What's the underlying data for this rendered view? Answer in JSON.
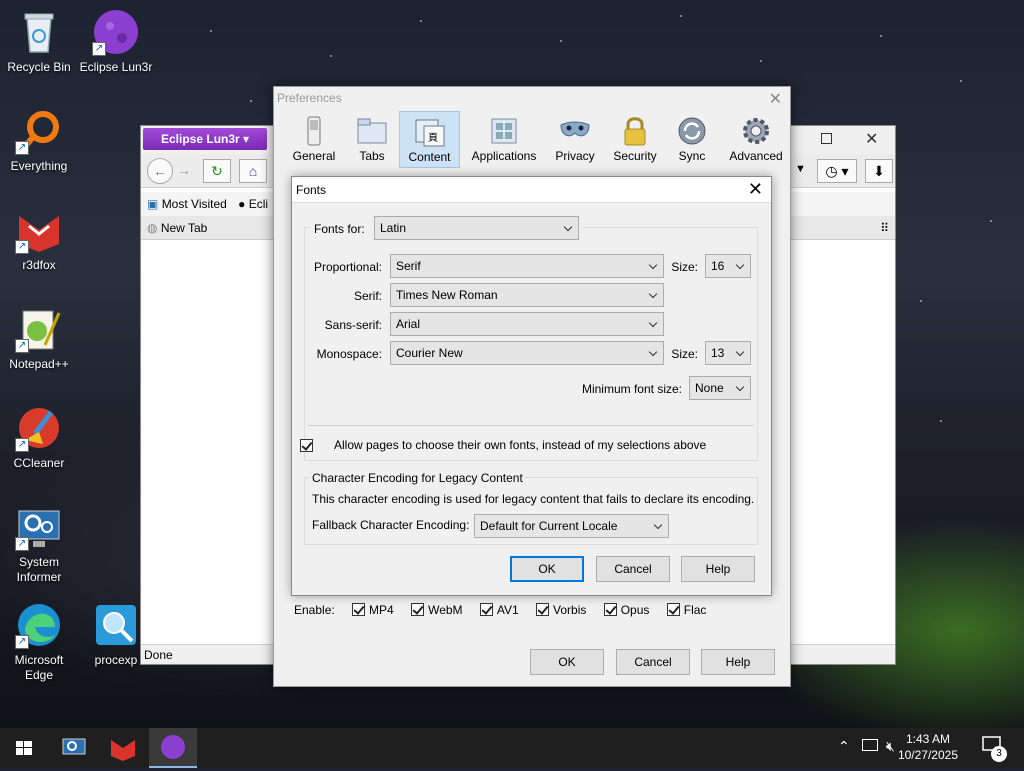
{
  "desktop": {
    "icons": [
      {
        "label": "Recycle Bin",
        "icon": "recycle-bin-icon"
      },
      {
        "label": "Eclipse Lun3r",
        "icon": "eclipse-lun3r-icon"
      },
      {
        "label": "Everything",
        "icon": "everything-search-icon"
      },
      {
        "label": "r3dfox",
        "icon": "r3dfox-icon"
      },
      {
        "label": "Notepad++",
        "icon": "notepad-plus-plus-icon"
      },
      {
        "label": "CCleaner",
        "icon": "ccleaner-icon"
      },
      {
        "label": "System Informer",
        "icon": "system-informer-icon"
      },
      {
        "label": "Microsoft Edge",
        "icon": "edge-icon"
      },
      {
        "label": "procexp",
        "icon": "procexp-icon"
      }
    ]
  },
  "browser": {
    "app_button": "Eclipse Lun3r",
    "bookmarks": [
      "Most Visited",
      "Ecli"
    ],
    "tab_label": "New Tab",
    "status": "Done"
  },
  "preferences": {
    "title": "Preferences",
    "panes": [
      {
        "label": "General",
        "icon": "general-switch-icon"
      },
      {
        "label": "Tabs",
        "icon": "tabs-icon"
      },
      {
        "label": "Content",
        "icon": "content-icon",
        "active": true
      },
      {
        "label": "Applications",
        "icon": "applications-icon"
      },
      {
        "label": "Privacy",
        "icon": "privacy-mask-icon"
      },
      {
        "label": "Security",
        "icon": "security-lock-icon"
      },
      {
        "label": "Sync",
        "icon": "sync-icon"
      },
      {
        "label": "Advanced",
        "icon": "advanced-gear-icon"
      }
    ],
    "enable_label": "Enable:",
    "formats": [
      "MP4",
      "WebM",
      "AV1",
      "Vorbis",
      "Opus",
      "Flac"
    ],
    "ok": "OK",
    "cancel": "Cancel",
    "help": "Help"
  },
  "fonts_dialog": {
    "title": "Fonts",
    "fonts_for_label": "Fonts for:",
    "fonts_for_value": "Latin",
    "proportional_label": "Proportional:",
    "proportional_value": "Serif",
    "size_label": "Size:",
    "proportional_size": "16",
    "serif_label": "Serif:",
    "serif_value": "Times New Roman",
    "sans_serif_label": "Sans-serif:",
    "sans_serif_value": "Arial",
    "monospace_label": "Monospace:",
    "monospace_value": "Courier New",
    "monospace_size": "13",
    "min_size_label": "Minimum font size:",
    "min_size_value": "None",
    "allow_pages_label": "Allow pages to choose their own fonts, instead of my selections above",
    "allow_pages_checked": true,
    "encoding_group_title": "Character Encoding for Legacy Content",
    "encoding_description": "This character encoding is used for legacy content that fails to declare its encoding.",
    "fallback_label": "Fallback Character Encoding:",
    "fallback_value": "Default for Current Locale",
    "ok": "OK",
    "cancel": "Cancel",
    "help": "Help"
  },
  "taskbar": {
    "time": "1:43 AM",
    "date": "10/27/2025",
    "notification_count": "3"
  }
}
